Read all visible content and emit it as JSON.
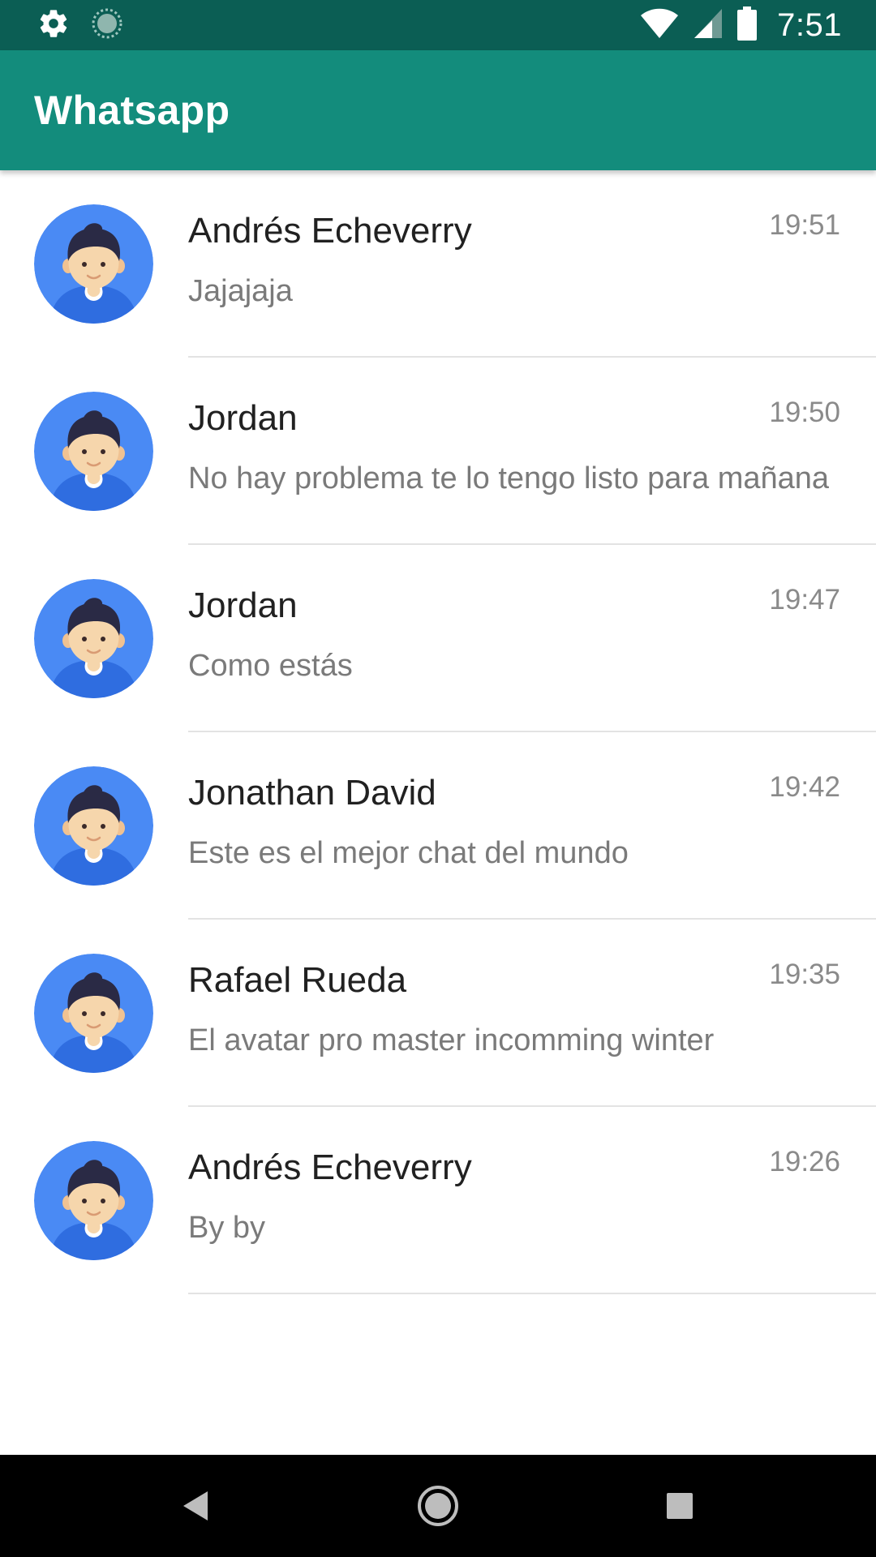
{
  "status_bar": {
    "time": "7:51",
    "icons": [
      "gear-icon",
      "sync-icon",
      "wifi-icon",
      "signal-icon",
      "battery-icon"
    ]
  },
  "app_bar": {
    "title": "Whatsapp",
    "background": "#138c7c",
    "status_background": "#0b5e54"
  },
  "chats": [
    {
      "name": "Andrés Echeverry",
      "message": "Jajajaja",
      "time": "19:51"
    },
    {
      "name": "Jordan",
      "message": "No hay problema te lo tengo listo para mañana",
      "time": "19:50"
    },
    {
      "name": "Jordan",
      "message": "Como estás",
      "time": "19:47"
    },
    {
      "name": "Jonathan David",
      "message": "Este es el mejor chat del mundo",
      "time": "19:42"
    },
    {
      "name": "Rafael Rueda",
      "message": "El avatar pro master incomming winter",
      "time": "19:35"
    },
    {
      "name": "Andrés Echeverry",
      "message": "By by",
      "time": "19:26"
    }
  ],
  "nav_bar": {
    "icons": [
      "back-icon",
      "home-icon",
      "recents-icon"
    ]
  },
  "colors": {
    "avatar_bg": "#4a8af4",
    "avatar_shirt": "#2f6de0",
    "avatar_skin": "#f6d6ac",
    "avatar_hair": "#2a2a45"
  }
}
